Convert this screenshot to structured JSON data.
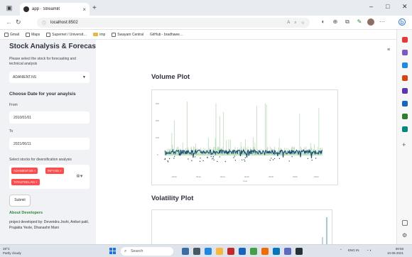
{
  "browser": {
    "tab_title": "app · Streamlit",
    "new_tab": "+",
    "url": "localhost:8502",
    "window_controls": [
      "–",
      "□",
      "✕"
    ],
    "bookmarks": [
      "Gmail",
      "Maps",
      "Supernet / Universit…",
      "imp",
      "Swayam Central",
      "GitHub - bradhawe…"
    ]
  },
  "sidebar": {
    "title": "Stock Analysis & Forecasting",
    "select_prompt": "Please select the stock for forecasting and technical analysis",
    "selected_stock": "ADANIENT.NS",
    "date_heading": "Choose Date for your anaylsis",
    "from_label": "From",
    "from_value": "2010/01/01",
    "to_label": "To",
    "to_value": "2021/06/11",
    "diversification_prompt": "Select stocks for diversification analysis",
    "chips": [
      "ADANIENT.NS ×",
      "INFY.NS ×",
      "TATASTEEL.NS ×"
    ],
    "submit_label": "Submit",
    "about_link": "About Developers",
    "credits": "project developed by: Devendra Joshi, Aniket patil, Prajakta Yeole, Dhanashri Mani"
  },
  "main": {
    "menu_icon": "≡",
    "volume_title": "Volume Plot",
    "volatility_title": "Volatility Plot"
  },
  "taskbar": {
    "weather_temp": "28°C",
    "weather_desc": "Partly cloudy",
    "search_placeholder": "Search",
    "tray_lang": "ENG IN",
    "time": "09:58",
    "date": "10-06-2021"
  },
  "colors": {
    "accent": "#ff4b4b",
    "sidebar_bg": "#f0f2f6",
    "volume_green": "#5cb85c",
    "volume_blue": "#1f4e79"
  }
}
